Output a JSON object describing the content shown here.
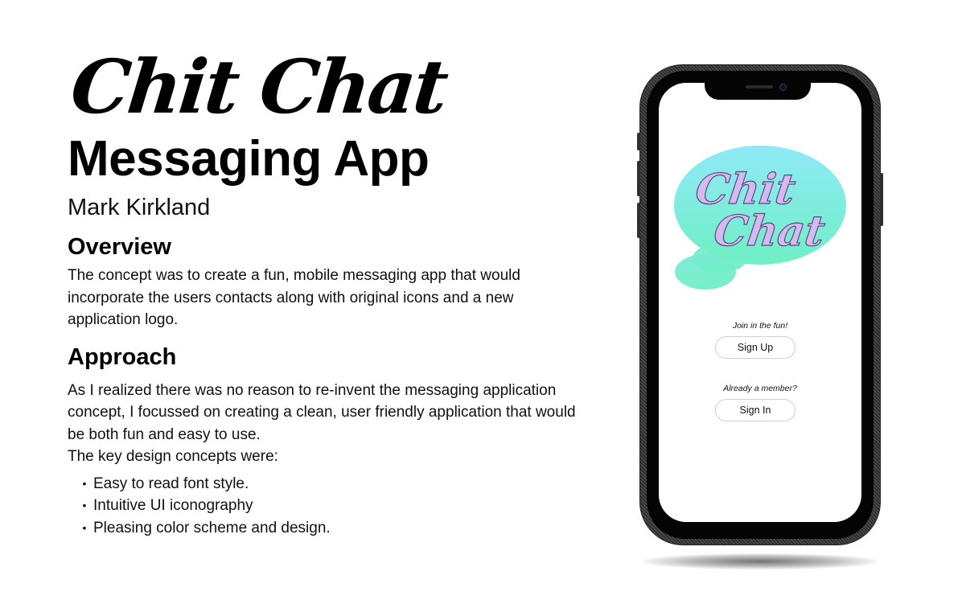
{
  "hero": {
    "script_title": "Chit Chat",
    "app_title": "Messaging App",
    "author": "Mark Kirkland"
  },
  "overview": {
    "heading": "Overview",
    "body": "The concept was to create a fun, mobile messaging app that would incorporate the users contacts along with original icons and a new application logo."
  },
  "approach": {
    "heading": "Approach",
    "body": "As I realized there was no reason to re-invent the messaging application concept, I focussed on creating a clean, user friendly application that would be both fun and easy to use.",
    "key_intro": "The key design concepts were:",
    "bullets": [
      "Easy to read font style.",
      "Intuitive UI iconography",
      "Pleasing color scheme and design."
    ]
  },
  "phone": {
    "logo_line1": "Chit",
    "logo_line2": "Chat",
    "join_caption": "Join in the fun!",
    "sign_up_label": "Sign Up",
    "member_caption": "Already a member?",
    "sign_in_label": "Sign In",
    "colors": {
      "bubble_top": "#8fe9f7",
      "bubble_bottom": "#6ff0c4",
      "logo_text": "#d7b8f2",
      "logo_outline": "#5a4a78"
    }
  }
}
